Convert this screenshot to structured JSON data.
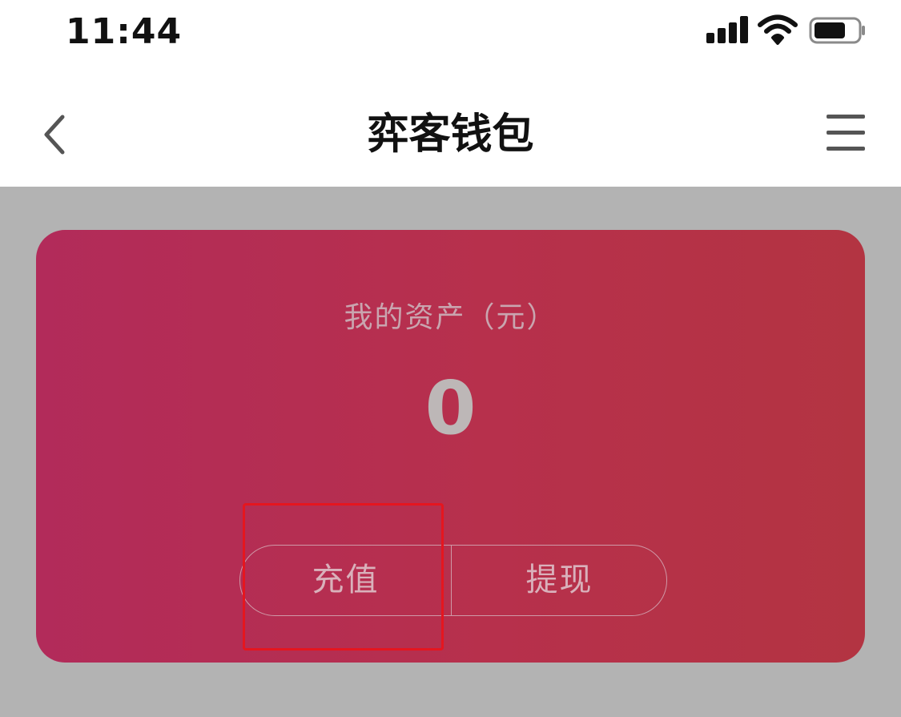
{
  "status_bar": {
    "time": "11:44",
    "signal_icon": "cellular-signal-icon",
    "wifi_icon": "wifi-icon",
    "battery_icon": "battery-icon"
  },
  "nav": {
    "title": "弈客钱包",
    "back_icon": "chevron-left-icon",
    "menu_icon": "hamburger-menu-icon"
  },
  "wallet": {
    "asset_label": "我的资产（元）",
    "asset_value": "0",
    "recharge_label": "充值",
    "withdraw_label": "提现"
  },
  "colors": {
    "card_gradient_start": "#b22b5a",
    "card_gradient_end": "#b33442",
    "overlay_background": "#b3b3b3",
    "highlight_border": "#e5161f"
  }
}
